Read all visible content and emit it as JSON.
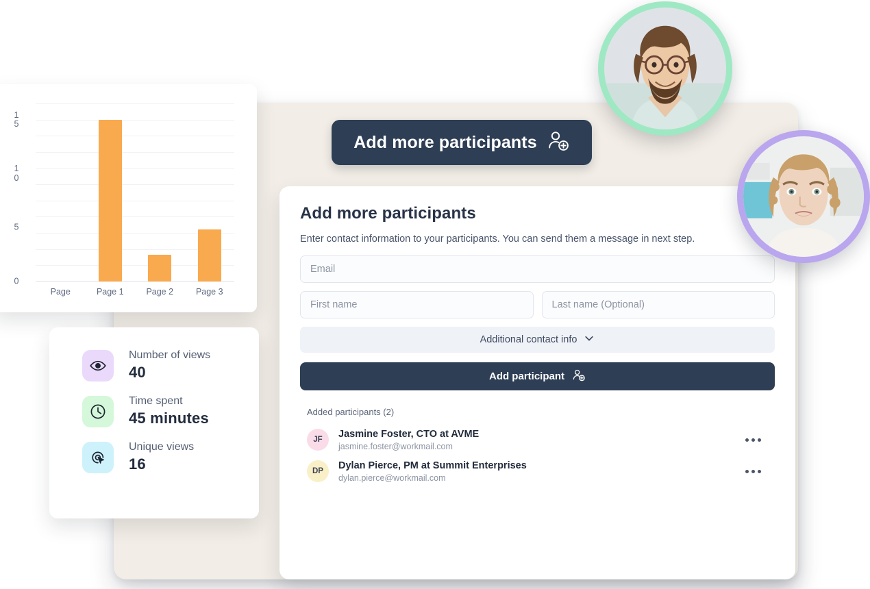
{
  "colors": {
    "panel_beige": "#f2ede6",
    "dark_navy": "#2e3e55",
    "bar_orange": "#f9a94e",
    "ring_green": "#9fe8c4",
    "ring_purple": "#b9a6ee",
    "avatar_pink": "#fadce8",
    "avatar_yellow": "#faf0c8",
    "icon_bg_lavender": "#ead9fb",
    "icon_bg_mint": "#d4f8d9",
    "icon_bg_cyan": "#cdf2fb"
  },
  "header_button": {
    "label": "Add more participants",
    "icon": "person-plus-icon"
  },
  "main_card": {
    "title": "Add more participants",
    "subtitle": "Enter contact information to your participants. You can send them a message in next step.",
    "fields": {
      "email_placeholder": "Email",
      "first_name_placeholder": "First name",
      "last_name_placeholder": "Last name (Optional)"
    },
    "accordion": {
      "label": "Additional contact info",
      "icon": "chevron-down-icon"
    },
    "add_button": {
      "label": "Add participant",
      "icon": "person-plus-icon"
    },
    "added": {
      "title": "Added participants (2)",
      "participants": [
        {
          "initials": "JF",
          "name": "Jasmine Foster, CTO at AVME",
          "email": "jasmine.foster@workmail.com",
          "avatar_color": "#fadce8"
        },
        {
          "initials": "DP",
          "name": "Dylan Pierce, PM at Summit Enterprises",
          "email": "dylan.pierce@workmail.com",
          "avatar_color": "#faf0c8"
        }
      ]
    }
  },
  "stats": {
    "items": [
      {
        "icon": "eye-icon",
        "label": "Number of views",
        "value": "40",
        "bg": "#ead9fb"
      },
      {
        "icon": "clock-icon",
        "label": "Time spent",
        "value": "45 minutes",
        "bg": "#d4f8d9"
      },
      {
        "icon": "cursor-click-icon",
        "label": "Unique views",
        "value": "16",
        "bg": "#cdf2fb"
      }
    ]
  },
  "avatars": [
    {
      "name": "avatar-photo-man",
      "ring_color": "#9fe8c4"
    },
    {
      "name": "avatar-photo-woman",
      "ring_color": "#b9a6ee"
    }
  ],
  "chart_data": {
    "type": "bar",
    "title": "",
    "xlabel": "",
    "ylabel": "",
    "categories": [
      "Page",
      "Page 1",
      "Page 2",
      "Page 3"
    ],
    "values": [
      0,
      15,
      2.5,
      4.8
    ],
    "yticks": [
      "15",
      "10",
      "5",
      "0"
    ],
    "ytick_values": [
      15,
      10,
      5,
      0
    ],
    "ylim": [
      0,
      16.5
    ],
    "grid": true,
    "gridlines": [
      16.5,
      15,
      13.5,
      12,
      10.5,
      9,
      7.5,
      6,
      4.5,
      3,
      1.5,
      0
    ],
    "bar_color": "#f9a94e",
    "legend": "none"
  }
}
